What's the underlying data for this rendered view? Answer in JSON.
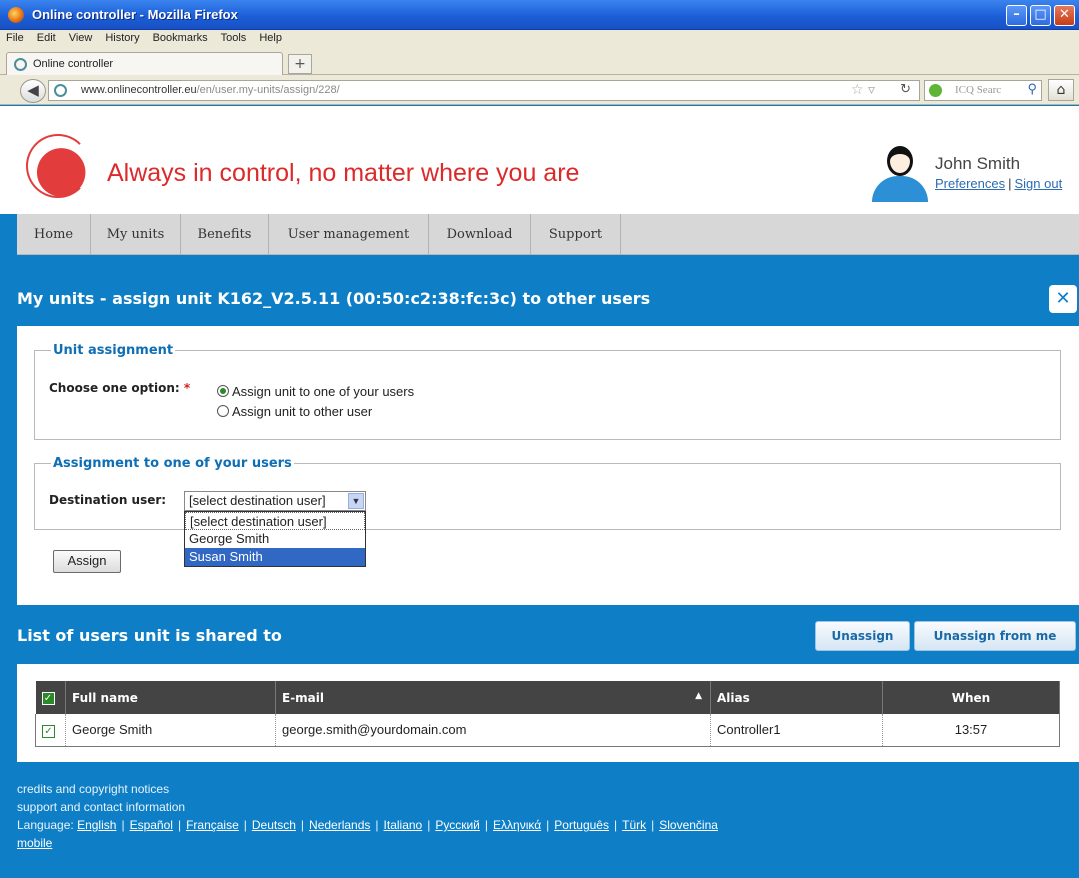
{
  "window": {
    "title": "Online controller - Mozilla Firefox"
  },
  "menu": [
    "File",
    "Edit",
    "View",
    "History",
    "Bookmarks",
    "Tools",
    "Help"
  ],
  "tab": {
    "label": "Online controller",
    "new_tab_symbol": "+"
  },
  "navbar": {
    "url_host": "www.onlinecontroller.eu",
    "url_path": "/en/user.my-units/assign/228/",
    "search_placeholder": "ICQ Searc"
  },
  "header": {
    "logo_text": "Online controller",
    "tagline": "Always in control, no matter where you are",
    "user_name": "John Smith",
    "preferences": "Preferences",
    "sign_out": "Sign out",
    "separator": "|"
  },
  "mainnav": [
    "Home",
    "My units",
    "Benefits",
    "User management",
    "Download",
    "Support"
  ],
  "panel": {
    "title": "My units - assign unit K162_V2.5.11 (00:50:c2:38:fc:3c) to other users",
    "close_symbol": "✕"
  },
  "unit_assignment": {
    "legend": "Unit assignment",
    "label": "Choose one option:",
    "required_mark": "*",
    "options": [
      "Assign unit to one of your users",
      "Assign unit to other user"
    ],
    "selected_index": 0
  },
  "destination": {
    "legend": "Assignment to one of your users",
    "label": "Destination user:",
    "select_value": "[select destination user]",
    "options": [
      "[select destination user]",
      "George Smith",
      "Susan Smith"
    ],
    "highlighted_option": "Susan Smith"
  },
  "assign_button": "Assign",
  "shared_list": {
    "title": "List of users unit is shared to",
    "unassign": "Unassign",
    "unassign_from_me": "Unassign from me",
    "columns": [
      "Full name",
      "E-mail",
      "Alias",
      "When"
    ],
    "rows": [
      {
        "full_name": "George Smith",
        "email": "george.smith@yourdomain.com",
        "alias": "Controller1",
        "when": "13:57",
        "checked": true
      }
    ]
  },
  "footer": {
    "credits": "credits and copyright notices",
    "support": "support and contact information",
    "language_label": "Language:",
    "languages": [
      "English",
      "Español",
      "Française",
      "Deutsch",
      "Nederlands",
      "Italiano",
      "Русский",
      "Ελληνικά",
      "Português",
      "Türk",
      "Slovenčina"
    ],
    "mobile": "mobile"
  },
  "colors": {
    "accent_blue": "#0e7fc6",
    "brand_red": "#dc2a2a",
    "selection_blue": "#3168c4"
  }
}
